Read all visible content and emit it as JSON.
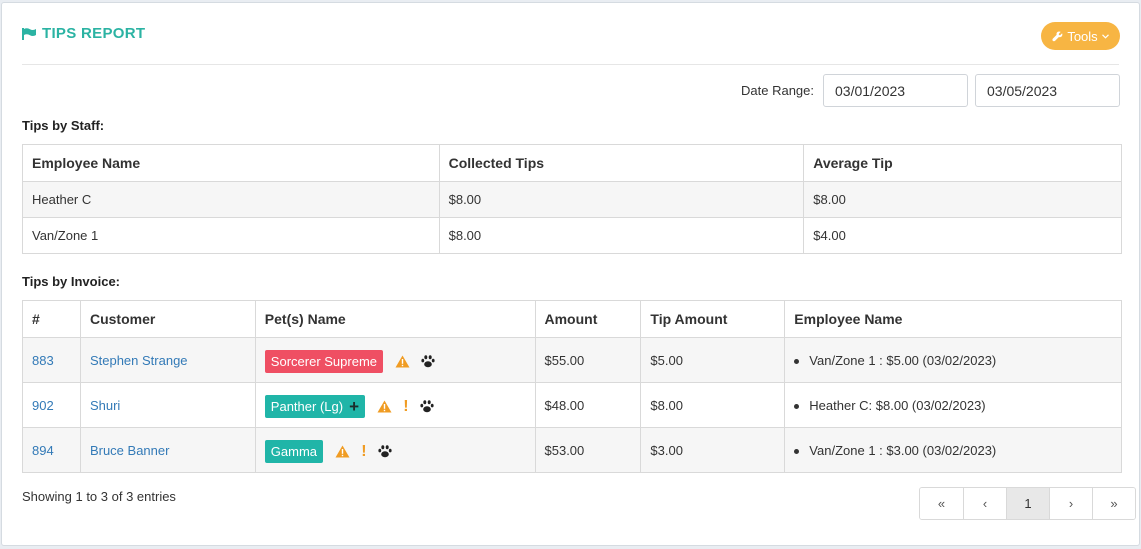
{
  "header": {
    "title": "TIPS REPORT",
    "tools_label": "Tools"
  },
  "date_range": {
    "label": "Date Range:",
    "start": "03/01/2023",
    "end": "03/05/2023"
  },
  "staff_section": {
    "label": "Tips by Staff:",
    "columns": [
      "Employee Name",
      "Collected Tips",
      "Average Tip"
    ],
    "rows": [
      {
        "employee": "Heather C",
        "collected": "$8.00",
        "average": "$8.00"
      },
      {
        "employee": "Van/Zone 1",
        "collected": "$8.00",
        "average": "$4.00"
      }
    ]
  },
  "invoice_section": {
    "label": "Tips by Invoice:",
    "columns": [
      "#",
      "Customer",
      "Pet(s) Name",
      "Amount",
      "Tip Amount",
      "Employee Name"
    ],
    "rows": [
      {
        "invoice": "883",
        "customer": "Stephen Strange",
        "pet": "Sorcerer Supreme",
        "pet_color": "#ef4f63",
        "amount": "$55.00",
        "tip": "$5.00",
        "employee": "Van/Zone 1 : $5.00 (03/02/2023)"
      },
      {
        "invoice": "902",
        "customer": "Shuri",
        "pet": "Panther (Lg)",
        "pet_color": "#20b5a8",
        "amount": "$48.00",
        "tip": "$8.00",
        "employee": "Heather C: $8.00 (03/02/2023)"
      },
      {
        "invoice": "894",
        "customer": "Bruce Banner",
        "pet": "Gamma",
        "pet_color": "#20b5a8",
        "amount": "$53.00",
        "tip": "$3.00",
        "employee": "Van/Zone 1 : $3.00 (03/02/2023)"
      }
    ]
  },
  "footer": {
    "showing": "Showing 1 to 3 of 3 entries"
  },
  "pagination": {
    "first": "«",
    "prev": "‹",
    "current": "1",
    "next": "›",
    "last": "»"
  },
  "colors": {
    "accent": "#2bb3a3",
    "tools": "#f7b543",
    "link": "#337ab7",
    "warning": "#f09c23"
  }
}
